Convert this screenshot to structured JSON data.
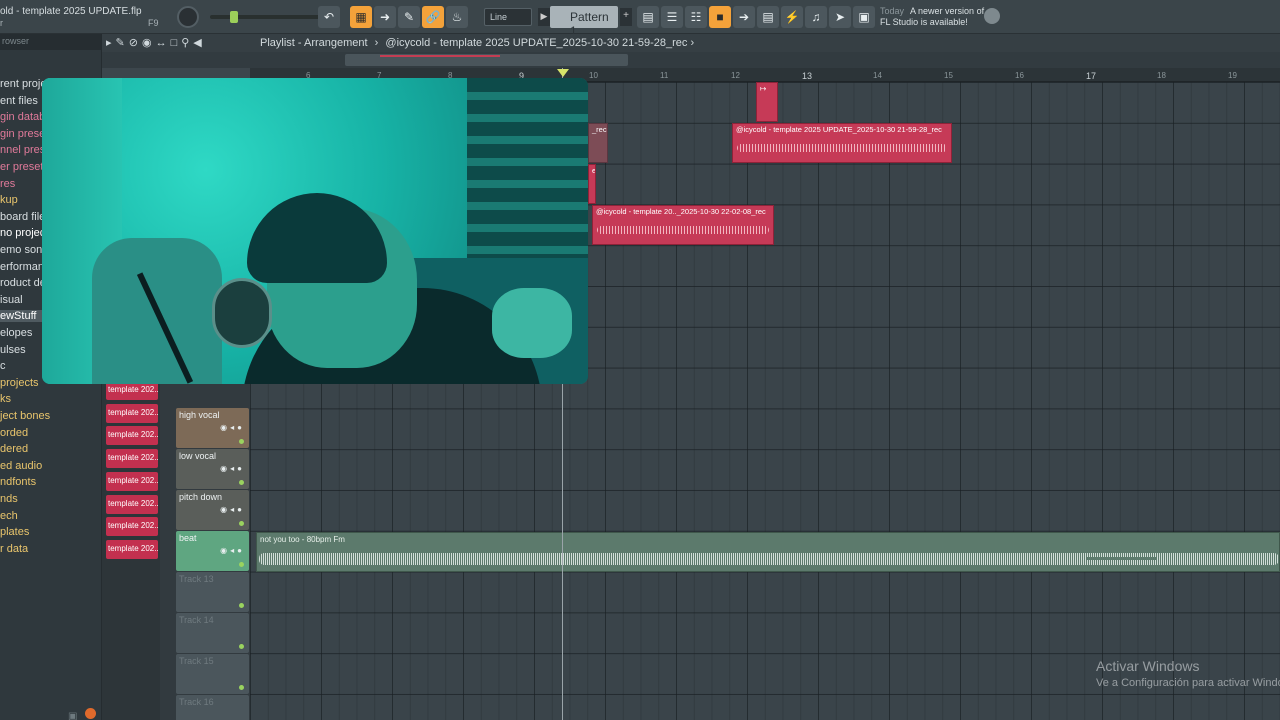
{
  "window": {
    "title": "old - template 2025 UPDATE.flp",
    "subtitle": "r",
    "f9_label": "F9"
  },
  "toolbar": {
    "snap_mode": "Line",
    "pattern": "Pattern 1",
    "news_today": "Today",
    "news_line1": "A newer version of",
    "news_line2": "FL Studio is available!"
  },
  "browser": {
    "header": "rowser",
    "items": [
      {
        "label": "rent proje",
        "color": "#d9dfe2"
      },
      {
        "label": "ent files",
        "color": "#d9dfe2"
      },
      {
        "label": "gin databa",
        "color": "#e07a9a"
      },
      {
        "label": "gin preset",
        "color": "#e07a9a"
      },
      {
        "label": "nnel prese",
        "color": "#e07a9a"
      },
      {
        "label": "er presets",
        "color": "#e07a9a"
      },
      {
        "label": "res",
        "color": "#e07a9a"
      },
      {
        "label": "kup",
        "color": "#e9c56c"
      },
      {
        "label": "board file",
        "color": "#d9dfe2"
      },
      {
        "label": "no project",
        "color": "#ffffff"
      },
      {
        "label": "emo songs",
        "color": "#d9dfe2"
      },
      {
        "label": "erforman",
        "color": "#d9dfe2"
      },
      {
        "label": "roduct de",
        "color": "#d9dfe2"
      },
      {
        "label": "isual",
        "color": "#d9dfe2"
      },
      {
        "label": "ewStuff",
        "color": "#ffffff"
      },
      {
        "label": "elopes",
        "color": "#d9dfe2"
      },
      {
        "label": "ulses",
        "color": "#d9dfe2"
      },
      {
        "label": "c",
        "color": "#d9dfe2"
      },
      {
        "label": "projects",
        "color": "#e9c56c"
      },
      {
        "label": "ks",
        "color": "#e9c56c"
      },
      {
        "label": "ject bones",
        "color": "#e9c56c"
      },
      {
        "label": "orded",
        "color": "#e9c56c"
      },
      {
        "label": "dered",
        "color": "#e9c56c"
      },
      {
        "label": "ed audio",
        "color": "#e9c56c"
      },
      {
        "label": "ndfonts",
        "color": "#e9c56c"
      },
      {
        "label": "nds",
        "color": "#e9c56c"
      },
      {
        "label": "ech",
        "color": "#e9c56c"
      },
      {
        "label": "plates",
        "color": "#e9c56c"
      },
      {
        "label": "r data",
        "color": "#e9c56c"
      }
    ]
  },
  "playlist": {
    "title": "Playlist - Arrangement",
    "breadcrumb": "@icycold - template 2025 UPDATE_2025-10-30 21-59-28_rec",
    "ruler": [
      "6",
      "7",
      "8",
      "9",
      "10",
      "11",
      "12",
      "13",
      "14",
      "15",
      "16",
      "17",
      "18",
      "19"
    ],
    "side_clips": [
      "template 202..",
      "template 202..",
      "template 202..",
      "template 202..",
      "template 202..",
      "template 202..",
      "template 202..",
      "template 202.."
    ],
    "tracks": [
      {
        "name": "high vocal"
      },
      {
        "name": "low vocal"
      },
      {
        "name": "pitch down"
      },
      {
        "name": "beat"
      },
      {
        "name": "Track 13"
      },
      {
        "name": "Track 14"
      },
      {
        "name": "Track 15"
      },
      {
        "name": "Track 16"
      }
    ],
    "clips": [
      {
        "label": "@icycold - template 2025 UPDATE_2025-10-30 21-59-28_rec"
      },
      {
        "label": "@icycold - template 20.._2025-10-30 22-02-08_rec"
      },
      {
        "label": "_rec"
      },
      {
        "label": "ec"
      }
    ],
    "beat_clip": "not you too - 80bpm Fm"
  },
  "watermark": {
    "line1": "Activar Windows",
    "line2": "Ve a Configuración para activar Windo"
  }
}
